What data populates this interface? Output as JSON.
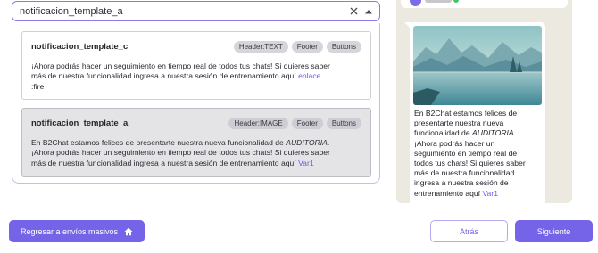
{
  "select": {
    "value": "notificacion_template_a",
    "clear_icon": "close-icon",
    "toggle_icon": "chevron-up-icon"
  },
  "options": [
    {
      "name": "notificacion_template_c",
      "badges": [
        "Header:TEXT",
        "Footer",
        "Buttons"
      ],
      "line1": "¡Ahora podrás hacer un seguimiento en tiempo real de todos tus chats! Si quieres saber",
      "line2_text": "más de nuestra funcionalidad ingresa a nuestra sesión de entrenamiento aquí ",
      "line2_link": "enlace",
      "line3": ":fire"
    },
    {
      "name": "notificacion_template_a",
      "badges": [
        "Header:IMAGE",
        "Footer",
        "Buttons"
      ],
      "line1_text": "En B2Chat estamos felices de presentarte nuestra nueva funcionalidad de ",
      "line1_em": "AUDITORIA",
      "line1_end": ".",
      "line2": "¡Ahora podrás hacer un seguimiento en tiempo real de todos tus chats! Si quieres saber",
      "line3_text": "más de nuestra funcionalidad ingresa a nuestra sesión de entrenamiento aquí ",
      "line3_link": "Var1"
    }
  ],
  "preview": {
    "lines": [
      "En B2Chat estamos felices de",
      "presentarte nuestra nueva",
      "funcionalidad de "
    ],
    "em": "AUDITORIA",
    "em_end": ".",
    "lines2": [
      "¡Ahora podrás hacer un",
      "seguimiento en tiempo real de",
      "todos tus chats! Si quieres saber",
      "más de nuestra funcionalidad",
      "ingresa a nuestra sesión de"
    ],
    "last_text": "entrenamiento aquí ",
    "last_link": "Var1"
  },
  "buttons": {
    "back_mass": "Regresar a envíos masivos",
    "back_icon": "home-icon",
    "atras": "Atrás",
    "siguiente": "Siguiente"
  },
  "colors": {
    "accent": "#7563e8",
    "link": "#6b5ce7",
    "preview_bg": "#ece9e1"
  }
}
